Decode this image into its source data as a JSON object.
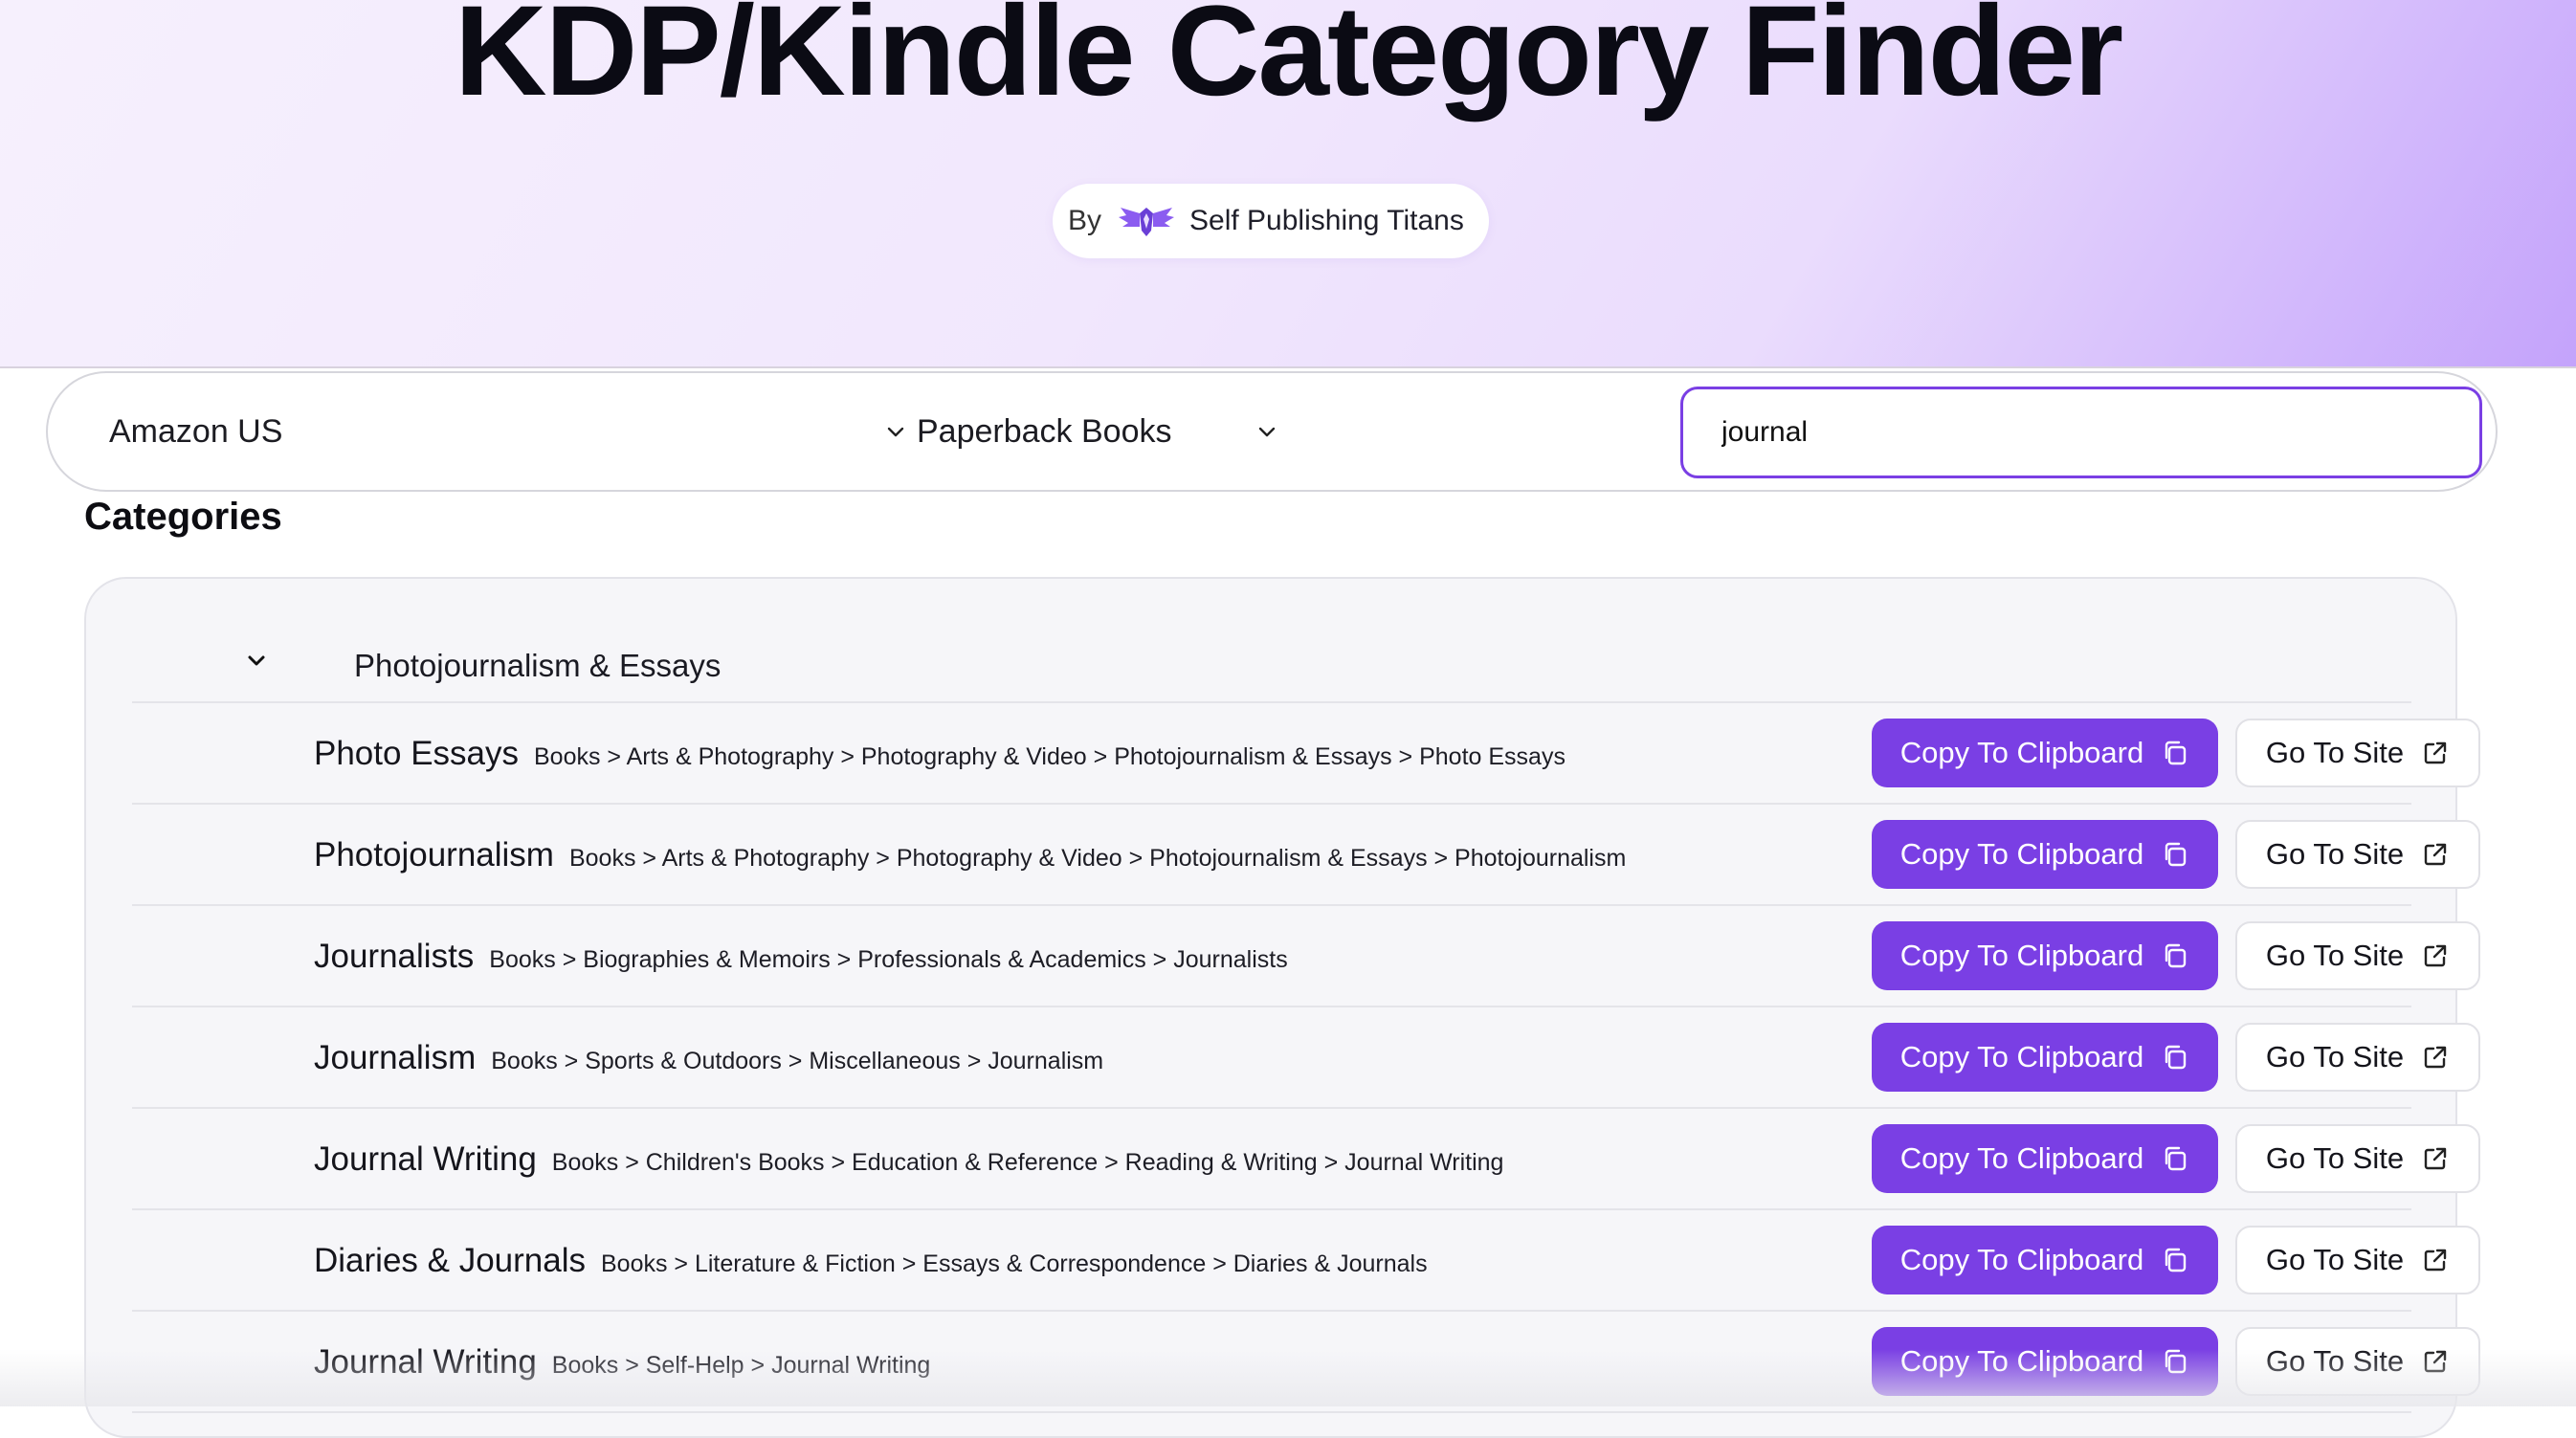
{
  "header": {
    "title": "KDP/Kindle Category Finder",
    "by_label": "By",
    "brand_name": "Self Publishing Titans",
    "brand_logo_icon": "winged-shield-logo-icon"
  },
  "filters": {
    "marketplace": "Amazon US",
    "format": "Paperback Books",
    "search_value": "journal"
  },
  "section_title": "Categories",
  "group": {
    "label": "Photojournalism & Essays",
    "expanded": true
  },
  "rows": [
    {
      "name": "Photo Essays",
      "path": "Books > Arts & Photography > Photography & Video > Photojournalism & Essays > Photo Essays"
    },
    {
      "name": "Photojournalism",
      "path": "Books > Arts & Photography > Photography & Video > Photojournalism & Essays > Photojournalism"
    },
    {
      "name": "Journalists",
      "path": "Books > Biographies & Memoirs > Professionals & Academics > Journalists"
    },
    {
      "name": "Journalism",
      "path": "Books > Sports & Outdoors > Miscellaneous > Journalism"
    },
    {
      "name": "Journal Writing",
      "path": "Books > Children's Books > Education & Reference > Reading & Writing > Journal Writing"
    },
    {
      "name": "Diaries & Journals",
      "path": "Books > Literature & Fiction > Essays & Correspondence > Diaries & Journals"
    },
    {
      "name": "Journal Writing",
      "path": "Books > Self-Help > Journal Writing"
    }
  ],
  "actions": {
    "copy_label": "Copy To Clipboard",
    "site_label": "Go To Site"
  },
  "colors": {
    "accent": "#7a3fe4",
    "hero_gradient_end": "#c4a3fb"
  }
}
